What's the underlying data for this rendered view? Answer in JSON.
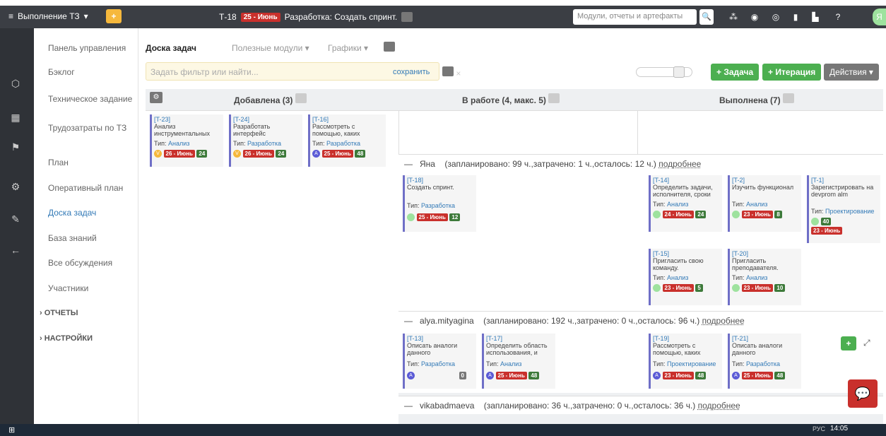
{
  "topbar": {
    "menu_label": "Выполнение ТЗ",
    "crumb_id": "Т-18",
    "crumb_date": "25 - Июнь",
    "crumb_title": "Разработка: Создать спринт.",
    "search_placeholder": "Модули, отчеты и артефакты",
    "avatar_letter": "Я"
  },
  "sidebar": {
    "items": [
      "Панель управления",
      "Бэклог",
      "Техническое задание",
      "Трудозатраты по ТЗ",
      "План",
      "Оперативный план",
      "Доска задач",
      "База знаний",
      "Все обсуждения",
      "Участники"
    ],
    "sections": [
      "ОТЧЕТЫ",
      "НАСТРОЙКИ"
    ]
  },
  "tabs": [
    "Доска задач",
    "Полезные модули",
    "Графики"
  ],
  "filter": {
    "placeholder": "Задать фильтр или найти...",
    "save": "сохранить"
  },
  "actions": {
    "task": "+ Задача",
    "iteration": "+ Итерация",
    "actions": "Действия"
  },
  "columns": [
    "Добавлена (3)",
    "В работе (4, макс. 5)",
    "Выполнена (7)"
  ],
  "type_prefix": "Тип:",
  "cards_added": [
    {
      "id": "[T-23]",
      "title": "Анализ инструментальных",
      "type": "Анализ",
      "avatar": "V",
      "date": "26 - Июнь",
      "num": "24"
    },
    {
      "id": "[T-24]",
      "title": "Разработать интерфейс",
      "type": "Разработка",
      "avatar": "V",
      "date": "26 - Июнь",
      "num": "24"
    },
    {
      "id": "[T-16]",
      "title": "Рассмотреть с помощью, каких",
      "type": "Разработка",
      "avatar": "A",
      "date": "25 - Июнь",
      "num": "48"
    }
  ],
  "swimlanes": [
    {
      "name": "Яна",
      "stats": "(запланировано: 99 ч.,затрачено: 1 ч.,осталось: 12 ч.)",
      "more": "подробнее"
    },
    {
      "name": "alya.mityagina",
      "stats": "(запланировано: 192 ч.,затрачено: 0 ч.,осталось: 96 ч.)",
      "more": "подробнее"
    },
    {
      "name": "vikabadmaeva",
      "stats": "(запланировано: 36 ч.,затрачено: 0 ч.,осталось: 36 ч.)",
      "more": "подробнее"
    }
  ],
  "cards_yana_work": [
    {
      "id": "[T-18]",
      "title": "Создать спринт.",
      "type": "Разработка",
      "date": "25 - Июнь",
      "num": "12"
    }
  ],
  "cards_yana_done": [
    {
      "id": "[T-14]",
      "title": "Определить задачи, исполнителя, сроки",
      "type": "Анализ",
      "date": "24 - Июнь",
      "num": "24"
    },
    {
      "id": "[T-2]",
      "title": "Изучить функционал",
      "type": "Анализ",
      "date": "23 - Июнь",
      "num": "8"
    },
    {
      "id": "[T-1]",
      "title": "Зарегистрировать на devprom alm",
      "type": "Проектирование",
      "date": "23 - Июнь",
      "num": "40"
    },
    {
      "id": "[T-15]",
      "title": "Пригласить свою команду.",
      "type": "Анализ",
      "date": "23 - Июнь",
      "num": "5"
    },
    {
      "id": "[T-20]",
      "title": "Пригласить преподавателя.",
      "type": "Анализ",
      "date": "23 - Июнь",
      "num": "10"
    }
  ],
  "cards_alya_work": [
    {
      "id": "[T-13]",
      "title": "Описать аналоги данного",
      "type": "Разработка",
      "num": "0"
    },
    {
      "id": "[T-17]",
      "title": "Определить область использования, и",
      "type": "Анализ",
      "date": "25 - Июнь",
      "num": "48"
    }
  ],
  "cards_alya_done": [
    {
      "id": "[T-19]",
      "title": "Рассмотреть с помощью, каких",
      "type": "Проектирование",
      "date": "23 - Июнь",
      "num": "48"
    },
    {
      "id": "[T-21]",
      "title": "Описать аналоги данного",
      "type": "Разработка",
      "date": "25 - Июнь",
      "num": "48"
    }
  ],
  "taskbar": {
    "time": "14:05",
    "lang": "РУС"
  }
}
